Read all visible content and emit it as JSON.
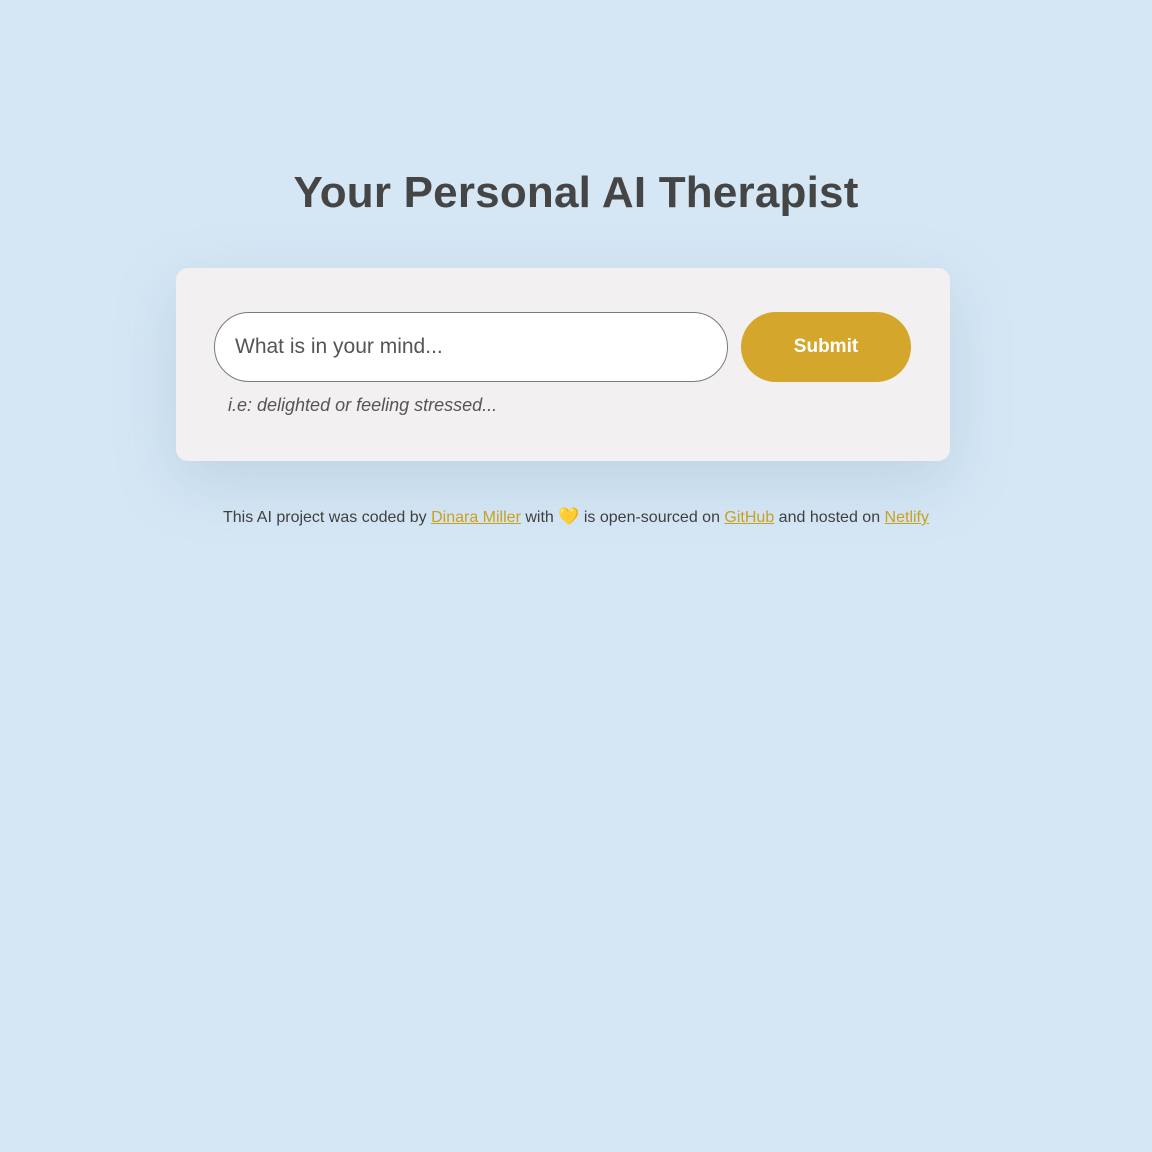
{
  "header": {
    "title": "Your Personal AI Therapist"
  },
  "form": {
    "input_placeholder": "What is in your mind...",
    "input_value": "",
    "submit_label": "Submit",
    "hint": "i.e: delighted or feeling stressed..."
  },
  "footer": {
    "text_1": "This AI project was coded by",
    "author_link": "Dinara Miller",
    "text_2": "with",
    "heart_icon": "heart-icon",
    "heart_glyph": "💛",
    "text_3": "is open-sourced on",
    "github_link": "GitHub",
    "text_4": "and hosted on",
    "netlify_link": "Netlify"
  },
  "colors": {
    "background": "#d5e7f5",
    "card": "#f2f0f0",
    "accent": "#d4a72c",
    "link": "#c9a020"
  }
}
